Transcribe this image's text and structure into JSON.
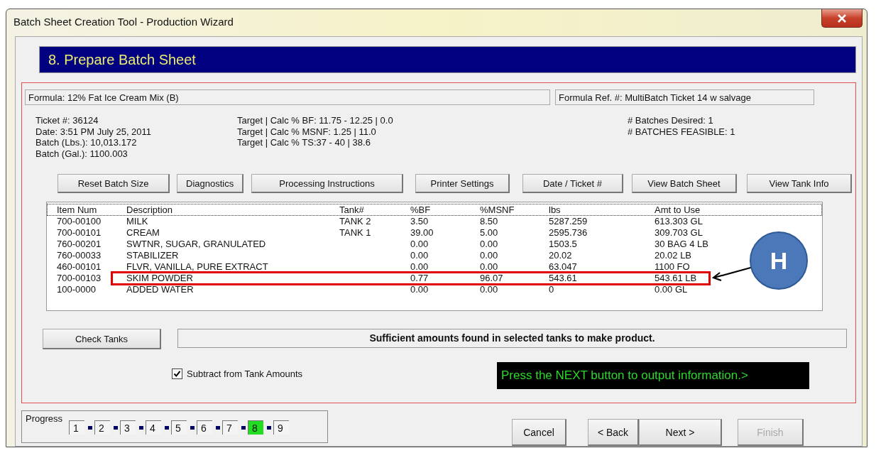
{
  "window": {
    "title": "Batch Sheet Creation Tool - Production Wizard"
  },
  "step_header": "8. Prepare Batch Sheet",
  "formula": "Formula:  12% Fat Ice Cream Mix (B)",
  "formula_ref": "Formula Ref.  #:  MultiBatch Ticket 14 w salvage",
  "info": {
    "left": [
      "Ticket #: 36124",
      "Date: 3:51 PM  July 25, 2011",
      "Batch (Lbs.): 10,013.172",
      "Batch (Gal.): 1100.003"
    ],
    "middle": [
      "Target | Calc % BF:  11.75 - 12.25 | 0.0",
      "Target | Calc % MSNF:  1.25 | 11.0",
      "Target | Calc % TS:37 - 40 | 38.6"
    ],
    "right": [
      "# Batches Desired: 1",
      "# BATCHES FEASIBLE: 1"
    ]
  },
  "toolbar_buttons": [
    "Reset Batch Size",
    "Diagnostics",
    "Processing Instructions",
    "Printer Settings",
    "Date / Ticket #",
    "View Batch Sheet",
    "View Tank Info"
  ],
  "table": {
    "columns": [
      "Item Num",
      "Description",
      "Tank#",
      "%BF",
      "%MSNF",
      "lbs",
      "Amt to Use"
    ],
    "rows": [
      {
        "item": "700-00100",
        "description": "MILK",
        "tank": "TANK 2",
        "bf": "3.50",
        "msnf": "8.50",
        "lbs": "5287.259",
        "amt": "613.303 GL",
        "highlighted": false
      },
      {
        "item": "700-00101",
        "description": "CREAM",
        "tank": "TANK 1",
        "bf": "39.00",
        "msnf": "5.00",
        "lbs": "2595.736",
        "amt": "309.703 GL",
        "highlighted": false
      },
      {
        "item": "760-00201",
        "description": "SWTNR, SUGAR, GRANULATED",
        "bf": "0.00",
        "msnf": "0.00",
        "lbs": "1503.5",
        "amt": "30 BAG 4 LB",
        "highlighted": false
      },
      {
        "item": "760-00033",
        "description": "STABILIZER",
        "bf": "0.00",
        "msnf": "0.00",
        "lbs": "20.02",
        "amt": "20.02 LB",
        "highlighted": false
      },
      {
        "item": "460-00101",
        "description": "FLVR, VANILLA, PURE EXTRACT",
        "bf": "0.00",
        "msnf": "0.00",
        "lbs": "63.047",
        "amt": "1100 FO",
        "highlighted": false
      },
      {
        "item": "700-00103",
        "description": "SKIM POWDER",
        "bf": "0.77",
        "msnf": "96.07",
        "lbs": "543.61",
        "amt": "543.61 LB",
        "highlighted": true
      },
      {
        "item": "100-0000",
        "description": "ADDED WATER",
        "bf": "0.00",
        "msnf": "0.00",
        "lbs": "0",
        "amt": "0.00 GL",
        "highlighted": false
      }
    ]
  },
  "callout": {
    "label": "H"
  },
  "check_tanks_button": "Check Tanks",
  "status_message": "Sufficient amounts found in selected tanks to make product.",
  "subtract_checkbox": {
    "label": "Subtract from Tank Amounts",
    "checked": true
  },
  "prompt": "Press the NEXT button to output information.>",
  "progress": {
    "label": "Progress",
    "steps": [
      {
        "label": "1",
        "selected": false
      },
      {
        "label": "2",
        "selected": false
      },
      {
        "label": "3",
        "selected": false
      },
      {
        "label": "4",
        "selected": false
      },
      {
        "label": "5",
        "selected": false
      },
      {
        "label": "6",
        "selected": false
      },
      {
        "label": "7",
        "selected": false
      },
      {
        "label": "8",
        "selected": true
      },
      {
        "label": "9",
        "selected": false
      }
    ]
  },
  "nav_buttons": [
    {
      "label": "Cancel",
      "disabled": false
    },
    {
      "label": "< Back",
      "disabled": false
    },
    {
      "label": "Next >",
      "disabled": false
    },
    {
      "label": "Finish",
      "disabled": true
    }
  ]
}
